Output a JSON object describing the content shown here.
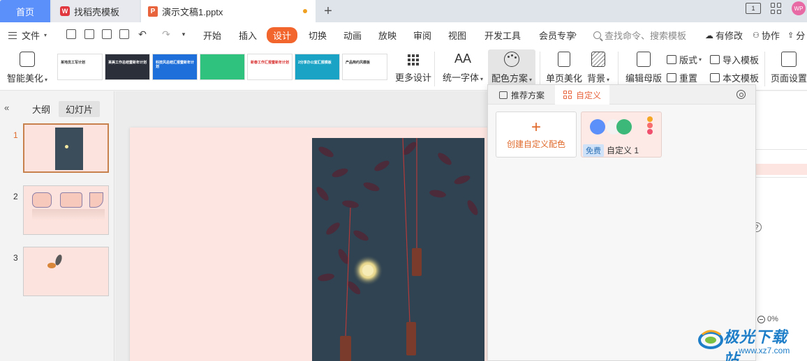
{
  "tabs": {
    "home": "首页",
    "templates": "找稻壳模板",
    "document": "演示文稿1.pptx",
    "window_badge": "1",
    "avatar_text": "WP"
  },
  "menu": {
    "file": "文件",
    "items": [
      "开始",
      "插入",
      "设计",
      "切换",
      "动画",
      "放映",
      "审阅",
      "视图",
      "开发工具",
      "会员专享"
    ],
    "active": "设计",
    "search_placeholder": "查找命令、搜索模板",
    "modified": "有修改",
    "collab": "协作",
    "share": "分"
  },
  "ribbon": {
    "smart_beautify": "智能美化",
    "more_designs": "更多设计",
    "unify_font": "统一字体",
    "color_scheme": "配色方案",
    "page_beautify": "单页美化",
    "background": "背景",
    "edit_master": "编辑母版",
    "layout": "版式",
    "reset": "重置",
    "import_template": "导入模板",
    "this_template": "本文模板",
    "page_setup": "页面设置",
    "thumbnails": [
      {
        "text": "某地员工写计划",
        "bg": "#ffffff",
        "fg": "#333333"
      },
      {
        "text": "某美工作总结暨新年计划",
        "bg": "#2b2f3a",
        "fg": "#ffffff"
      },
      {
        "text": "科技风总结汇报暨新年计划",
        "bg": "#1e6fd9",
        "fg": "#ffffff"
      },
      {
        "text": "",
        "bg": "#2ec27e",
        "fg": "#ffffff"
      },
      {
        "text": "新春工作汇报暨新年计划",
        "bg": "#ffffff",
        "fg": "#d83030"
      },
      {
        "text": "2分享办公室汇报模板",
        "bg": "#1ba3c6",
        "fg": "#ffffff"
      },
      {
        "text": "产品简约风模板",
        "bg": "#ffffff",
        "fg": "#333333"
      }
    ]
  },
  "left_panel": {
    "outline": "大纲",
    "slides_tab": "幻灯片",
    "slide_numbers": [
      "1",
      "2",
      "3"
    ]
  },
  "dropdown": {
    "tab_recommended": "推荐方案",
    "tab_custom": "自定义",
    "create_label": "创建自定义配色",
    "scheme_badge": "免费",
    "scheme_name": "自定义 1",
    "scheme_colors": [
      "#5b8ff9",
      "#f2f2f2",
      "#3cb878",
      "#f5a623",
      "#f76c6c",
      "#f0506e"
    ]
  },
  "status": {
    "zoom": "0%"
  },
  "watermark": {
    "title": "极光下载站",
    "url": "www.xz7.com"
  },
  "colors": {
    "accent": "#f2662e",
    "home_tab": "#5b8ff9",
    "slide_bg": "#fde6e1"
  }
}
